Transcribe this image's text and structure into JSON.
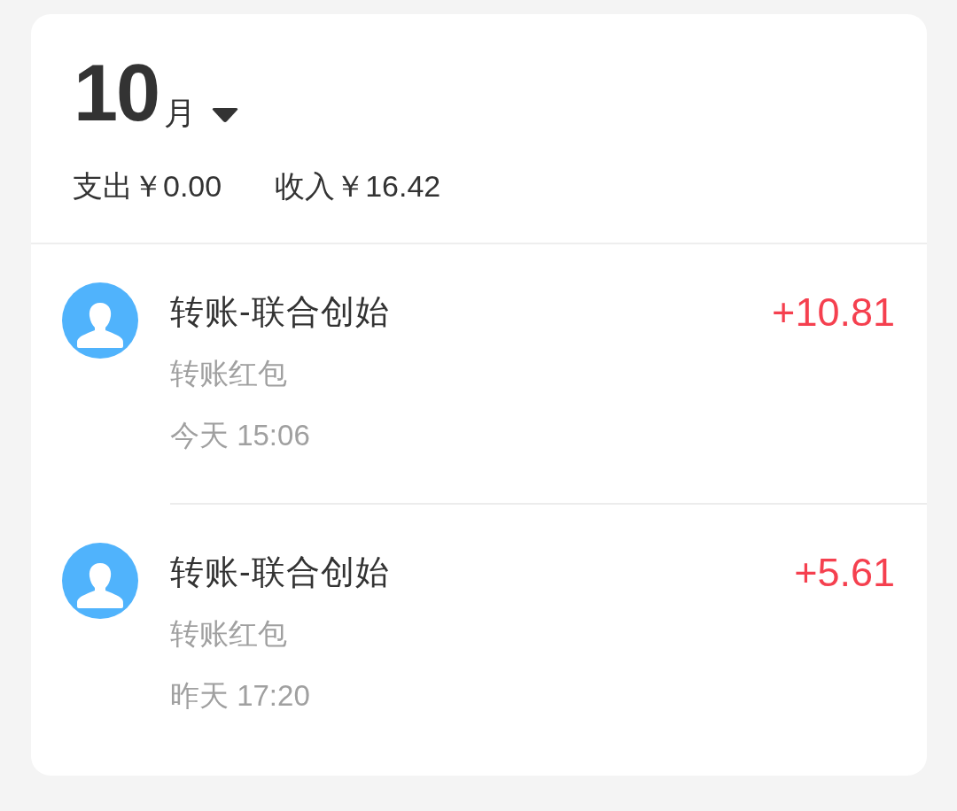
{
  "header": {
    "month": "10",
    "month_unit": "月"
  },
  "summary": [
    {
      "label": "支出",
      "amount": "￥0.00"
    },
    {
      "label": "收入",
      "amount": "￥16.42"
    }
  ],
  "transactions": [
    {
      "title": "转账-联合创始",
      "subtitle": "转账红包",
      "time": "今天 15:06",
      "amount": "+10.81"
    },
    {
      "title": "转账-联合创始",
      "subtitle": "转账红包",
      "time": "昨天 17:20",
      "amount": "+5.61"
    }
  ]
}
